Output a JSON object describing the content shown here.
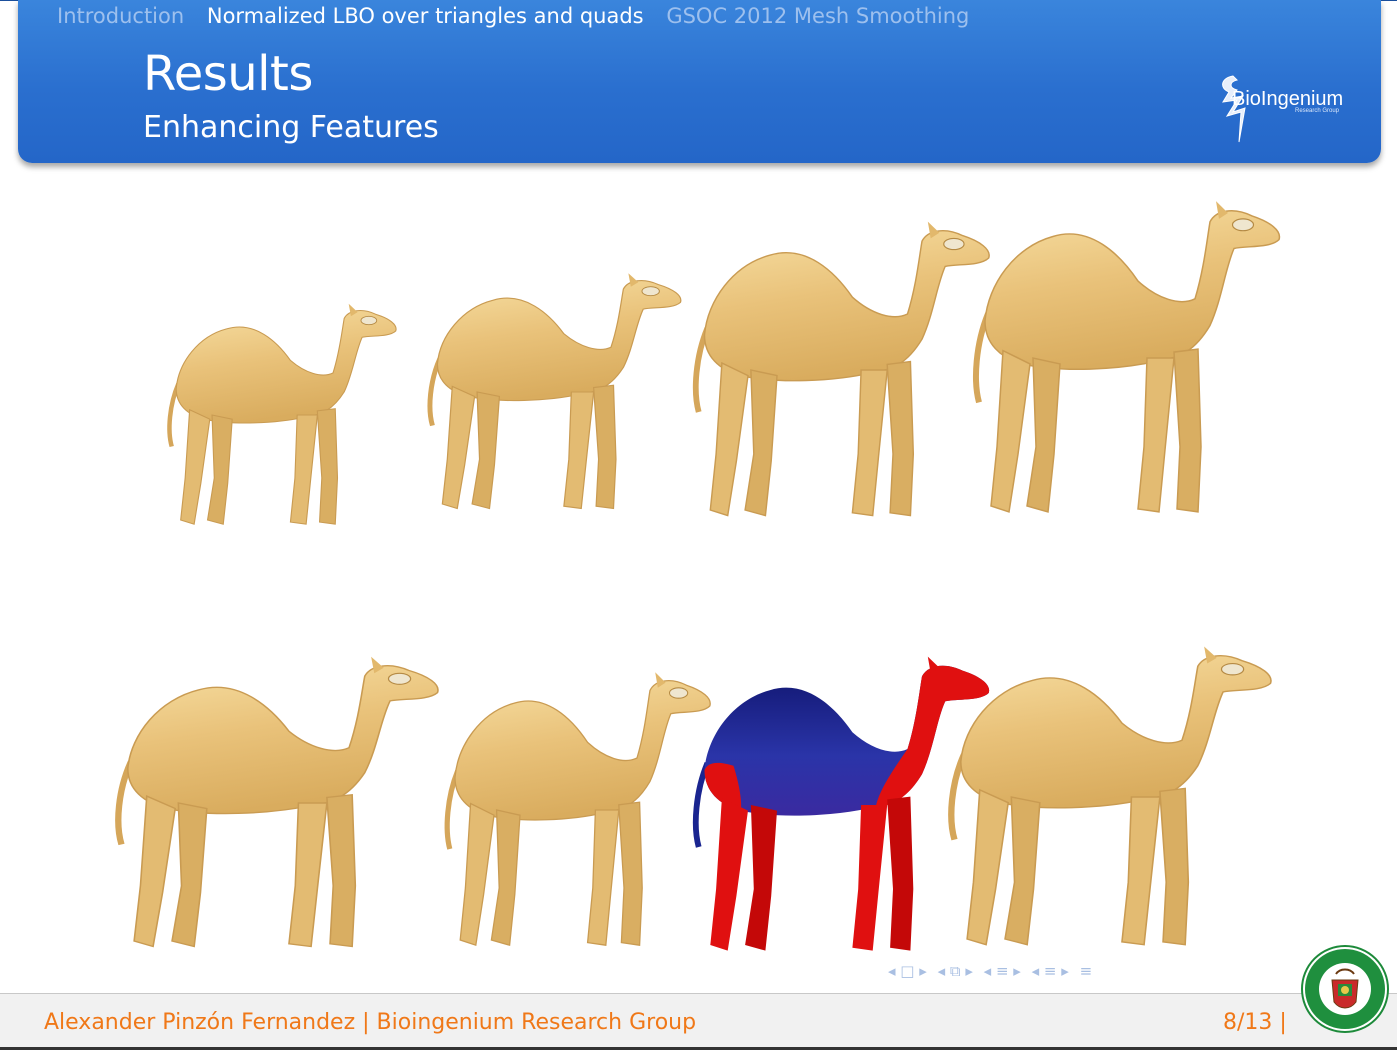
{
  "header": {
    "nav": [
      "Introduction",
      "Normalized LBO over triangles and quads",
      "GSOC 2012 Mesh Smoothing"
    ],
    "active_index": 1,
    "title": "Results",
    "subtitle": "Enhancing Features",
    "logo_text": "BioIngenium",
    "logo_sub": "Research Group"
  },
  "beamer_nav": [
    "◂ □ ▸",
    "◂ ⧉ ▸",
    "◂ ≡ ▸",
    "◂ ≡ ▸",
    "≡"
  ],
  "footer": {
    "author": "Alexander Pinzón Fernandez | Bioingenium Research Group",
    "page": "8/13 |"
  },
  "colors": {
    "header_blue": "#2a6fcf",
    "camel": "#e9c57a",
    "highlight_red": "#e01010",
    "highlight_blue": "#1a2590",
    "footer_text": "#f07818"
  },
  "images": [
    "camel-mesh",
    "camel-mesh",
    "camel-mesh",
    "camel-mesh",
    "camel-mesh",
    "camel-mesh",
    "camel-mesh-segmented",
    "camel-mesh"
  ]
}
